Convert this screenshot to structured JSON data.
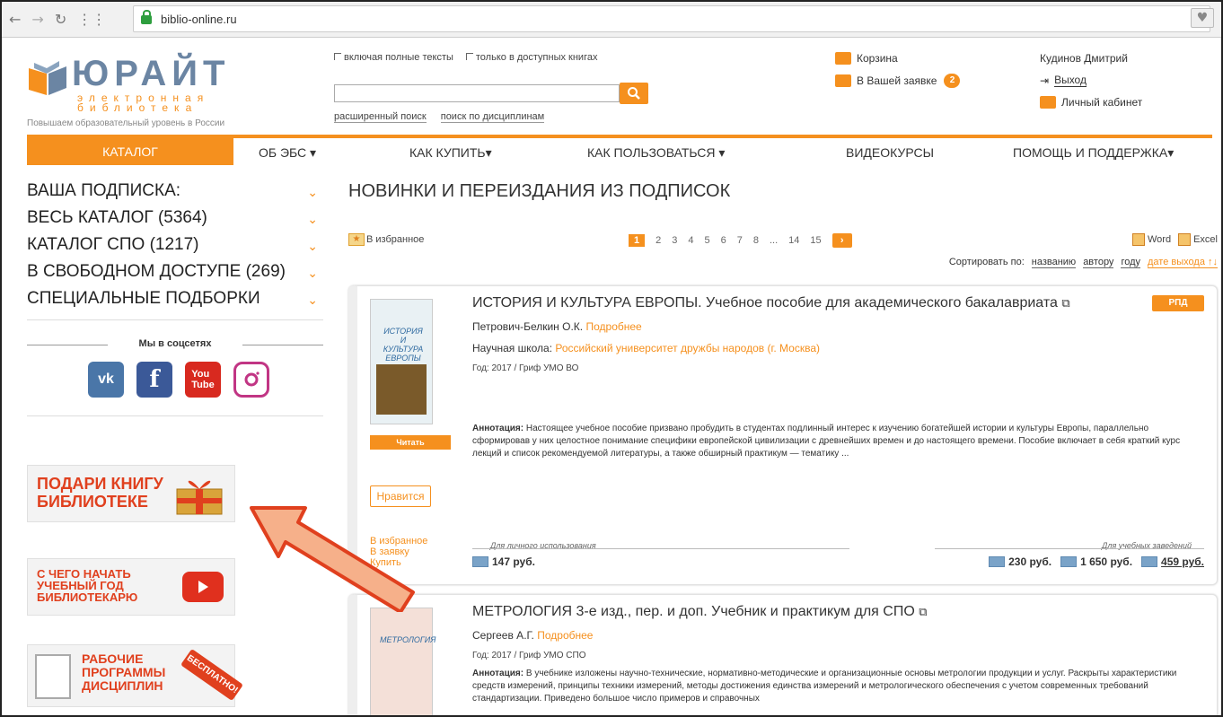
{
  "browser": {
    "url": "biblio-online.ru"
  },
  "header": {
    "logo_title": "ЮРАЙТ",
    "logo_sub": "электронная библиотека",
    "logo_slogan": "Повышаем образовательный уровень в России",
    "checkbox_fulltext": "включая полные тексты",
    "checkbox_available": "только в доступных книгах",
    "search_placeholder": "",
    "advanced_search": "расширенный поиск",
    "discipline_search": "поиск по дисциплинам",
    "cart_label": "Корзина",
    "request_label": "В Вашей заявке",
    "request_count": "2",
    "user_name": "Кудинов Дмитрий",
    "logout": "Выход",
    "cabinet": "Личный кабинет"
  },
  "nav": {
    "catalog": "КАТАЛОГ",
    "about": "ОБ ЭБС ▾",
    "buy": "КАК КУПИТЬ▾",
    "use": "КАК ПОЛЬЗОВАТЬСЯ ▾",
    "video": "ВИДЕОКУРСЫ",
    "help": "ПОМОЩЬ И ПОДДЕРЖКА▾"
  },
  "sidebar": {
    "items": [
      {
        "label": "ВАША ПОДПИСКА:"
      },
      {
        "label": "ВЕСЬ КАТАЛОГ (5364)"
      },
      {
        "label": "КАТАЛОГ СПО (1217)"
      },
      {
        "label": "В СВОБОДНОМ ДОСТУПЕ (269)"
      },
      {
        "label": "СПЕЦИАЛЬНЫЕ ПОДБОРКИ"
      }
    ],
    "social_title": "Мы в соцсетях",
    "banner1": "ПОДАРИ КНИГУ БИБЛИОТЕКЕ",
    "banner2": "С ЧЕГО НАЧАТЬ УЧЕБНЫЙ ГОД БИБЛИОТЕКАРЮ",
    "banner3": "РАБОЧИЕ ПРОГРАММЫ ДИСЦИПЛИН",
    "banner3_tag": "БЕСПЛАТНО!"
  },
  "content": {
    "title": "НОВИНКИ И ПЕРЕИЗДАНИЯ ИЗ ПОДПИСОК",
    "favorites": "В избранное",
    "pages": [
      "1",
      "2",
      "3",
      "4",
      "5",
      "6",
      "7",
      "8",
      "...",
      "14",
      "15"
    ],
    "export_word": "Word",
    "export_excel": "Excel",
    "sort_by": "Сортировать по:",
    "sort_title": "названию",
    "sort_author": "автору",
    "sort_year": "году",
    "sort_date": "дате выхода"
  },
  "books": [
    {
      "cover_title": "ИСТОРИЯ И КУЛЬТУРА ЕВРОПЫ",
      "title": "ИСТОРИЯ И КУЛЬТУРА ЕВРОПЫ. Учебное пособие для академического бакалавриата",
      "author": "Петрович-Белкин О.К.",
      "more": "Подробнее",
      "school_label": "Научная школа:",
      "school": "Российский университет дружбы народов (г. Москва)",
      "year": "Год: 2017 / Гриф УМО ВО",
      "annot_label": "Аннотация:",
      "annot": "Настоящее учебное пособие призвано пробудить в студентах подлинный интерес к изучению богатейшей истории и культуры Европы, параллельно сформировав у них целостное понимание специфики европейской цивилизации с древнейших времен и до настоящего времени. Пособие включает в себя краткий курс лекций и список рекомендуемой литературы, а также обширный практикум — тематику ...",
      "read": "Читать",
      "like": "Нравится",
      "link_fav": "В избранное",
      "link_req": "В заявку",
      "link_cut": "Купить",
      "badge": "РПД",
      "personal_label": "Для личного использования",
      "price_personal": "147 руб.",
      "inst_label": "Для учебных заведений",
      "price_1": "230 руб.",
      "price_2": "1 650 руб.",
      "price_3": "459 руб."
    },
    {
      "cover_title": "МЕТРОЛОГИЯ",
      "title": "МЕТРОЛОГИЯ 3-е изд., пер. и доп. Учебник и практикум для СПО",
      "author": "Сергеев А.Г.",
      "more": "Подробнее",
      "year": "Год: 2017 / Гриф УМО СПО",
      "annot_label": "Аннотация:",
      "annot": "В учебнике изложены научно-технические, нормативно-методические и организационные основы метрологии продукции и услуг. Раскрыты характеристики средств измерений, принципы техники измерений, методы достижения единства измерений и метрологического обеспечения с учетом современных требований стандартизации. Приведено большое число примеров и справочных"
    }
  ],
  "colors": {
    "accent": "#f5901e",
    "arrow_fill": "#f6b08a",
    "arrow_stroke": "#e0401e"
  }
}
